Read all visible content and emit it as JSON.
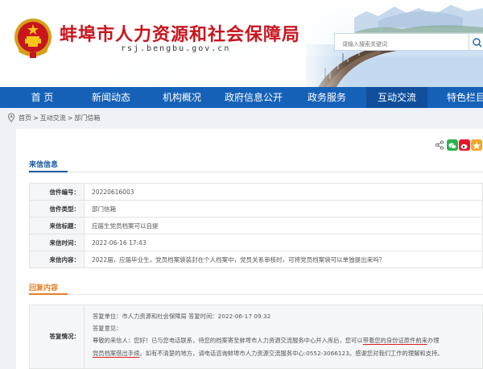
{
  "header": {
    "site_title": "蚌埠市人力资源和社会保障局",
    "site_url": "rsj.bengbu.gov.cn",
    "search_placeholder": "请输入搜索关键词"
  },
  "nav": {
    "items": [
      "首 页",
      "新闻动态",
      "机构概况",
      "政府信息公开",
      "政务服务",
      "互动交流",
      "特色栏目"
    ],
    "active": "互动交流"
  },
  "breadcrumb": [
    "首页",
    ">",
    "互动交流",
    ">",
    "部门信箱"
  ],
  "letter": {
    "heading": "来信信息",
    "rows": [
      {
        "label": "信件编号：",
        "value": "20220616003"
      },
      {
        "label": "信件类型：",
        "value": "部门信箱"
      },
      {
        "label": "来信标题：",
        "value": "应届生党员档案可以自提"
      },
      {
        "label": "来信时间：",
        "value": "2022-06-16 17:43"
      },
      {
        "label": "来信内容：",
        "value": "2022届，应届毕业生，党员档案袋装封在个人档案中，党员关系审核时，可将党员档案袋可以单独提出来吗？"
      }
    ]
  },
  "reply": {
    "heading": "回复内容",
    "label": "答复情况：",
    "unit_line": "答复单位：市人力资源和社会保障局     答复时间：2022-06-17 09:32",
    "opinion_label": "答复意见：",
    "body_line1_a": "尊敬的来信人：您好！已与您电话联系，待您的档案寄至蚌埠市人力资源交流服务中心并入库后，您可以",
    "body_line1_b": "带着您的身份证原件前来",
    "body_line1_c": "办理",
    "body_line2_a": "党员档案借出手续",
    "body_line2_b": "。如有不清楚的地方，请电话咨询蚌埠市人力资源交流服务中心:0552-3066123。感谢您对我们工作的理解和支持。"
  },
  "colors": {
    "brand_red": "#c9151e",
    "nav_blue": "#1661b8",
    "section_blue": "#1a5aa6",
    "section_orange": "#e67e22"
  }
}
